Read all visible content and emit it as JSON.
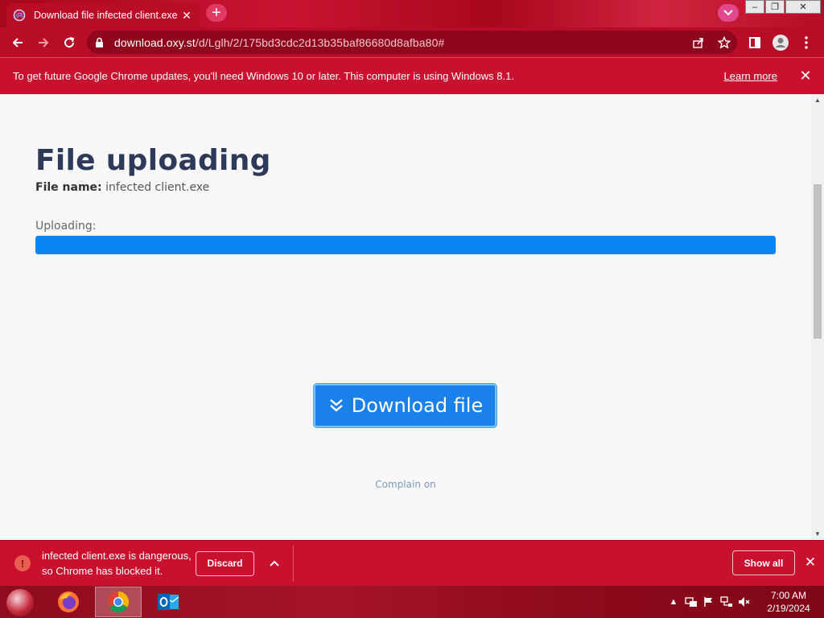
{
  "browser": {
    "tab": {
      "title": "Download file infected client.exe",
      "close_symbol": "✕"
    },
    "new_tab_symbol": "+",
    "window_controls": {
      "minimize": "–",
      "restore": "❐",
      "close": "✕"
    },
    "address": {
      "host": "download.oxy.st",
      "path": "/d/Lglh/2/175bd3cdc2d13b35baf86680d8afba80#"
    }
  },
  "infobar": {
    "message": "To get future Google Chrome updates, you'll need Windows 10 or later. This computer is using Windows 8.1.",
    "link": "Learn more",
    "close_symbol": "✕"
  },
  "page": {
    "title": "File uploading",
    "file_name_label": "File name:",
    "file_name_value": "infected client.exe",
    "uploading_label": "Uploading:",
    "progress": 1.0,
    "download_button": "Download file",
    "complain_link": "Complain on"
  },
  "download_shelf": {
    "message_line1": "infected client.exe is dangerous,",
    "message_line2": "so Chrome has blocked it.",
    "warning_symbol": "!",
    "discard_label": "Discard",
    "show_all_label": "Show all",
    "close_symbol": "✕"
  },
  "taskbar": {
    "apps": [
      "firefox-icon",
      "chrome-icon",
      "outlook-icon"
    ],
    "active_app": "chrome-icon",
    "time": "7:00 AM",
    "date": "2/19/2024"
  },
  "colors": {
    "theme": "#b80c27",
    "accent_blue": "#1a80ea",
    "progress_blue": "#0a84f0",
    "title_text": "#2e3a5a"
  }
}
